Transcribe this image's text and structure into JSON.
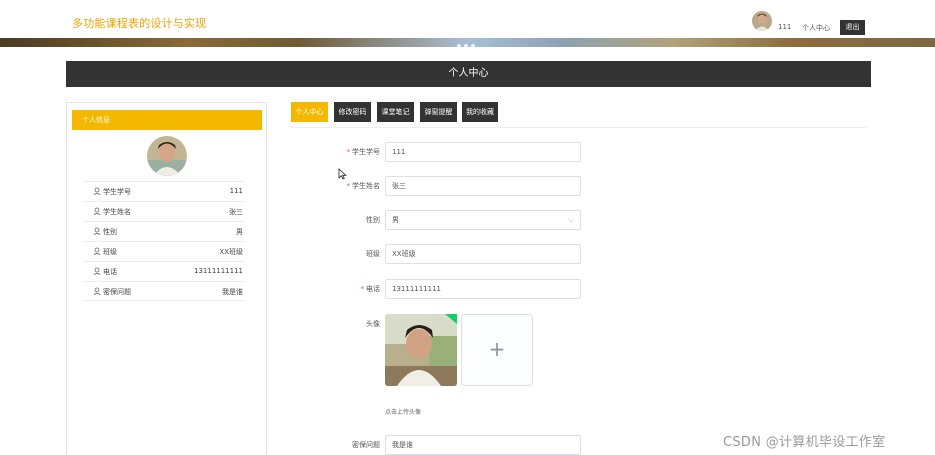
{
  "header": {
    "site_title": "多功能课程表的设计与实现",
    "username": "111",
    "nav_profile": "个人中心",
    "logout": "退出"
  },
  "page_title": "个人中心",
  "left_panel": {
    "tab_label": "个人信息",
    "rows": [
      {
        "label": "学生学号",
        "value": "111"
      },
      {
        "label": "学生姓名",
        "value": "张三"
      },
      {
        "label": "性别",
        "value": "男"
      },
      {
        "label": "班级",
        "value": "XX班级"
      },
      {
        "label": "电话",
        "value": "13111111111"
      },
      {
        "label": "密保问题",
        "value": "我是谁"
      }
    ]
  },
  "tabs": [
    "个人中心",
    "修改密码",
    "课堂笔记",
    "弹窗提醒",
    "我的收藏"
  ],
  "form": {
    "student_id": {
      "label": "学生学号",
      "value": "111"
    },
    "student_name": {
      "label": "学生姓名",
      "value": "张三"
    },
    "gender": {
      "label": "性别",
      "value": "男"
    },
    "class": {
      "label": "班级",
      "value": "XX班级"
    },
    "phone": {
      "label": "电话",
      "value": "13111111111"
    },
    "avatar": {
      "label": "头像",
      "tip": "点击上传头像",
      "add": "+"
    },
    "security_question": {
      "label": "密保问题",
      "value": "我是谁"
    }
  },
  "colors": {
    "accent": "#f5b800",
    "dark": "#333333"
  },
  "watermark": "CSDN @计算机毕设工作室"
}
